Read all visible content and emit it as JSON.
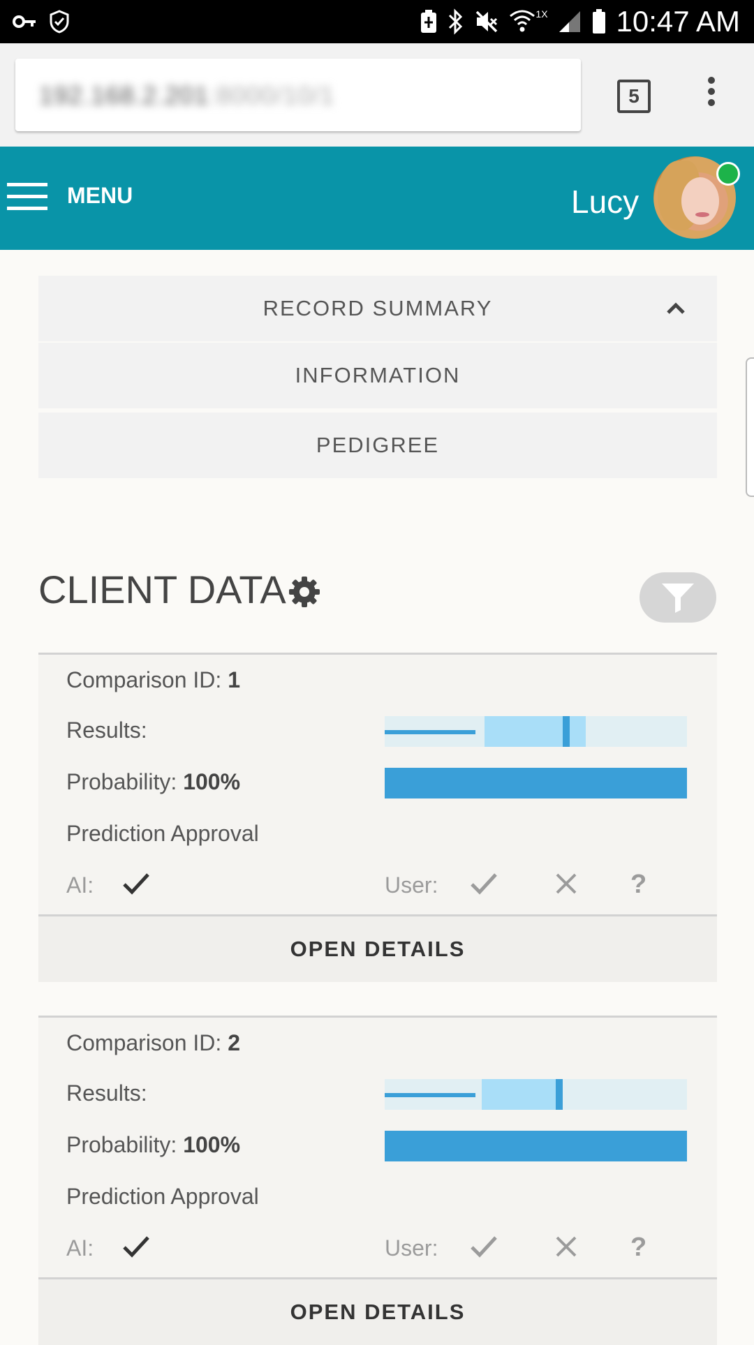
{
  "status_bar": {
    "time": "10:47 AM",
    "wifi_label": "1X",
    "icons": [
      "key-icon",
      "shield-icon",
      "battery-saver-icon",
      "bluetooth-icon",
      "mute-icon",
      "wifi-icon",
      "signal-icon",
      "battery-icon"
    ]
  },
  "browser": {
    "url_main": "192.168.2.201",
    "url_rest": ":8000/10/1",
    "tab_count": "5"
  },
  "header": {
    "menu_label": "MENU",
    "user_name": "Lucy",
    "online_color": "#1db34a",
    "bar_color": "#0994a8"
  },
  "accordion": {
    "items": [
      {
        "label": "RECORD SUMMARY",
        "expanded": true
      },
      {
        "label": "INFORMATION"
      },
      {
        "label": "PEDIGREE"
      }
    ]
  },
  "client_data": {
    "title": "CLIENT DATA",
    "labels": {
      "comparison_id": "Comparison ID:",
      "results": "Results:",
      "probability": "Probability:",
      "prediction_approval": "Prediction Approval",
      "ai": "AI:",
      "user": "User:",
      "question": "?",
      "open_details": "OPEN DETAILS"
    },
    "cards": [
      {
        "comparison_id": "1",
        "probability": "100%",
        "probability_fraction": 1.0,
        "results": {
          "line_end": 0.3,
          "range_start": 0.33,
          "range_end": 0.665,
          "marker": 0.59
        },
        "ai_approved": true
      },
      {
        "comparison_id": "2",
        "probability": "100%",
        "probability_fraction": 1.0,
        "results": {
          "line_end": 0.3,
          "range_start": 0.32,
          "range_end": 0.59,
          "marker": 0.565
        },
        "ai_approved": true
      }
    ]
  }
}
